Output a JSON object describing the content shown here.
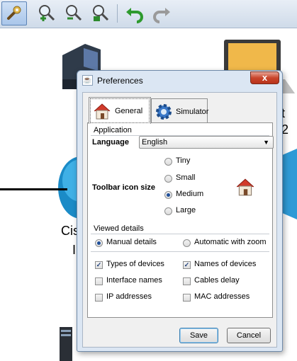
{
  "toolbar": {
    "buttons": [
      {
        "name": "settings-wrench-icon",
        "active": true
      },
      {
        "name": "zoom-in-icon"
      },
      {
        "name": "zoom-out-icon"
      },
      {
        "name": "zoom-reset-icon"
      },
      {
        "name": "undo-icon"
      },
      {
        "name": "redo-icon"
      }
    ]
  },
  "background": {
    "cisco_partial": "Cis",
    "cisco_partial_2": "I",
    "right_partial_1": "t",
    "right_partial_2": "2"
  },
  "dialog": {
    "title": "Preferences",
    "close_label": "x",
    "tabs": [
      {
        "label": "General",
        "icon": "house-icon",
        "active": true
      },
      {
        "label": "Simulator",
        "icon": "gear-icon",
        "active": false
      }
    ],
    "application": {
      "group_title": "Application",
      "language_label": "Language",
      "language_value": "English",
      "icon_size_label": "Toolbar icon size",
      "icon_sizes": [
        {
          "label": "Tiny",
          "selected": false
        },
        {
          "label": "Small",
          "selected": false
        },
        {
          "label": "Medium",
          "selected": true
        },
        {
          "label": "Large",
          "selected": false
        }
      ]
    },
    "viewed_details": {
      "group_title": "Viewed details",
      "modes": [
        {
          "label": "Manual details",
          "selected": true
        },
        {
          "label": "Automatic with zoom",
          "selected": false
        }
      ],
      "checks": [
        {
          "label": "Types of devices",
          "checked": true
        },
        {
          "label": "Names of devices",
          "checked": true
        },
        {
          "label": "Interface names",
          "checked": false
        },
        {
          "label": "Cables delay",
          "checked": false
        },
        {
          "label": "IP addresses",
          "checked": false
        },
        {
          "label": "MAC addresses",
          "checked": false
        }
      ]
    },
    "save_label": "Save",
    "cancel_label": "Cancel"
  },
  "colors": {
    "accent": "#1f4f9a",
    "close": "#c9462c",
    "house_roof": "#d23a2a"
  }
}
